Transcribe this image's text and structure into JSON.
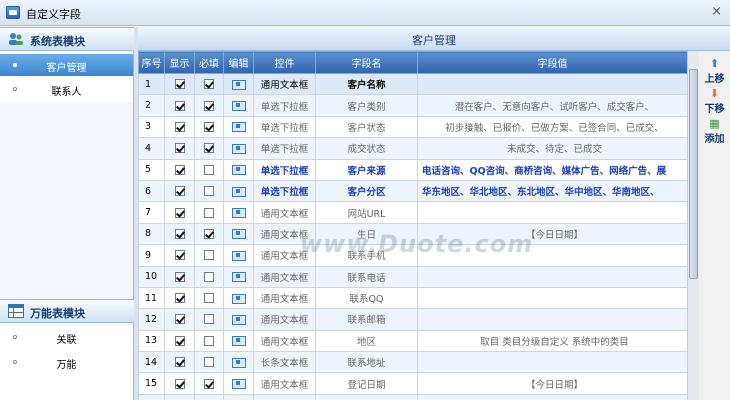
{
  "window": {
    "title": "自定义字段",
    "close_glyph": "×"
  },
  "left_panel": {
    "module1": {
      "label": "系统表模块",
      "items": [
        {
          "label": "客户管理",
          "selected": true
        },
        {
          "label": "联系人",
          "selected": false
        }
      ]
    },
    "module2": {
      "label": "万能表模块",
      "items": [
        {
          "label": "关联"
        },
        {
          "label": "万能"
        }
      ]
    }
  },
  "main": {
    "title": "客户管理"
  },
  "grid": {
    "columns": [
      "序号",
      "显示",
      "必填",
      "编辑",
      "控件",
      "字段名",
      "字段值"
    ],
    "rows": [
      {
        "no": "1",
        "show": true,
        "req": true,
        "ctrl": "通用文本框",
        "field": "客户名称",
        "value": ""
      },
      {
        "no": "2",
        "show": true,
        "req": true,
        "ctrl": "单选下拉框",
        "field": "客户类别",
        "value": "潜在客户、无意向客户、试听客户、成交客户、"
      },
      {
        "no": "3",
        "show": true,
        "req": true,
        "ctrl": "单选下拉框",
        "field": "客户状态",
        "value": "初步接触、已报价、已做方案、已签合同、已成交、"
      },
      {
        "no": "4",
        "show": true,
        "req": true,
        "ctrl": "单选下拉框",
        "field": "成交状态",
        "value": "未成交、待定、已成交"
      },
      {
        "no": "5",
        "show": true,
        "req": false,
        "ctrl": "单选下拉框",
        "field": "客户来源",
        "value": "电话咨询、QQ咨询、商桥咨询、媒体广告、网络广告、展"
      },
      {
        "no": "6",
        "show": true,
        "req": false,
        "ctrl": "单选下拉框",
        "field": "客户分区",
        "value": "华东地区、华北地区、东北地区、华中地区、华南地区、"
      },
      {
        "no": "7",
        "show": true,
        "req": false,
        "ctrl": "通用文本框",
        "field": "网站URL",
        "value": ""
      },
      {
        "no": "8",
        "show": true,
        "req": true,
        "ctrl": "通用文本框",
        "field": "生日",
        "value": "【今日日期】"
      },
      {
        "no": "9",
        "show": true,
        "req": false,
        "ctrl": "通用文本框",
        "field": "联系手机",
        "value": ""
      },
      {
        "no": "10",
        "show": true,
        "req": false,
        "ctrl": "通用文本框",
        "field": "联系电话",
        "value": ""
      },
      {
        "no": "11",
        "show": true,
        "req": false,
        "ctrl": "通用文本框",
        "field": "联系QQ",
        "value": ""
      },
      {
        "no": "12",
        "show": true,
        "req": false,
        "ctrl": "通用文本框",
        "field": "联系邮箱",
        "value": ""
      },
      {
        "no": "13",
        "show": true,
        "req": false,
        "ctrl": "通用文本框",
        "field": "地区",
        "value": "取目 类目分级自定义 系统中的类目"
      },
      {
        "no": "14",
        "show": true,
        "req": false,
        "ctrl": "长条文本框",
        "field": "联系地址",
        "value": ""
      },
      {
        "no": "15",
        "show": true,
        "req": true,
        "ctrl": "通用文本框",
        "field": "登记日期",
        "value": "【今日日期】"
      },
      {
        "no": "16",
        "show": true,
        "req": false,
        "ctrl": "通用文本框",
        "field": "回访日期",
        "value": "【今日日期】"
      }
    ]
  },
  "side_buttons": [
    {
      "label": "上移",
      "icon": "up-arrow-icon",
      "glyph": "⬆"
    },
    {
      "label": "下移",
      "icon": "down-arrow-icon",
      "glyph": "⬇"
    },
    {
      "label": "添加",
      "icon": "add-icon",
      "glyph": "▦"
    }
  ],
  "watermark": "www.Duote.com",
  "colors": {
    "header_blue": "#3a71b8",
    "selected": "#4a93d8",
    "link_blue": "#1a3fb8"
  }
}
